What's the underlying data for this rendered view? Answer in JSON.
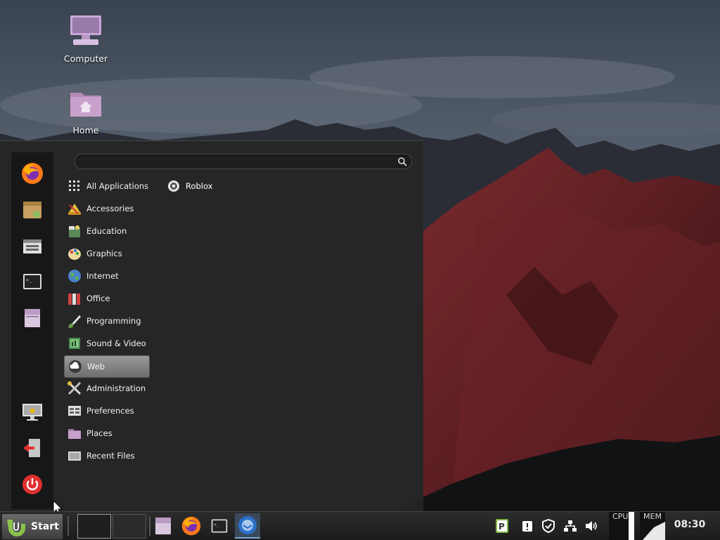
{
  "desktop": {
    "icons": [
      {
        "label": "Computer"
      },
      {
        "label": "Home"
      }
    ]
  },
  "menu": {
    "search": {
      "value": "",
      "placeholder": ""
    },
    "categories": [
      {
        "label": "All Applications",
        "icon": "grid-icon"
      },
      {
        "label": "Accessories",
        "icon": "accessories-icon"
      },
      {
        "label": "Education",
        "icon": "education-icon"
      },
      {
        "label": "Graphics",
        "icon": "graphics-icon"
      },
      {
        "label": "Internet",
        "icon": "globe-icon"
      },
      {
        "label": "Office",
        "icon": "office-icon"
      },
      {
        "label": "Programming",
        "icon": "programming-icon"
      },
      {
        "label": "Sound & Video",
        "icon": "sound-video-icon"
      },
      {
        "label": "Web",
        "icon": "cloud-icon",
        "selected": true
      },
      {
        "label": "Administration",
        "icon": "tools-icon"
      },
      {
        "label": "Preferences",
        "icon": "preferences-icon"
      },
      {
        "label": "Places",
        "icon": "folder-icon"
      },
      {
        "label": "Recent Files",
        "icon": "recent-files-icon"
      }
    ],
    "apps": [
      {
        "label": "Roblox",
        "icon": "roblox-icon"
      }
    ],
    "favorites": [
      "firefox-icon",
      "software-manager-icon",
      "synaptic-icon",
      "terminal-icon",
      "files-icon"
    ],
    "session": [
      "lock-screen-icon",
      "logout-icon",
      "power-icon"
    ]
  },
  "taskbar": {
    "start_label": "Start",
    "workspaces": 2,
    "launchers": [
      "files-icon",
      "firefox-icon",
      "terminal-icon",
      "thunderbird-icon"
    ],
    "tray": [
      "pia-icon",
      "update-manager-icon",
      "shield-icon",
      "network-icon",
      "volume-icon"
    ],
    "cpu_label": "CPU",
    "mem_label": "MEM",
    "clock": "08:30"
  },
  "colors": {
    "menu_bg": "#262626",
    "panel_bg": "#1c1c1c",
    "accent": "#7aa7d8"
  }
}
